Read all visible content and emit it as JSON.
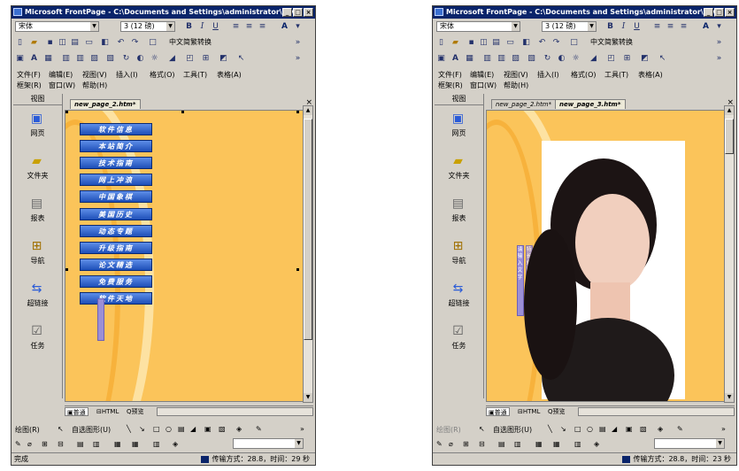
{
  "window_left": {
    "title": "Microsoft FrontPage - C:\\Documents and Settings\\administrator\\My...",
    "font_name": "宋体",
    "font_size": "3 (12 磅)",
    "format_buttons": [
      "B",
      "I",
      "U"
    ],
    "a_button": "A",
    "convert_label": "中文简繁转换",
    "menus_row1": [
      "文件(F)",
      "编辑(E)",
      "视图(V)",
      "插入(I)",
      "格式(O)",
      "工具(T)",
      "表格(A)"
    ],
    "menus_row2": [
      "框架(R)",
      "窗口(W)",
      "帮助(H)"
    ],
    "sidebar_title": "视图",
    "sidebar_items": [
      "网页",
      "文件夹",
      "报表",
      "导航",
      "超链接",
      "任务"
    ],
    "tabs": [
      "new_page_2.htm*"
    ],
    "nav_buttons": [
      "软件信息",
      "本站简介",
      "技术指南",
      "网上冲浪",
      "中国象棋",
      "美国历史",
      "动态专题",
      "升级指南",
      "论文精选",
      "免费服务",
      "软件天地"
    ],
    "view_tabs": [
      "普通",
      "HTML",
      "预览"
    ],
    "draw_label": "绘图(R)",
    "autoshapes_label": "自选图形(U)",
    "status_left": "完成",
    "status_right": "传输方式：28.8，时间：29 秒"
  },
  "window_right": {
    "title": "Microsoft FrontPage - C:\\Documents and Settings\\administrator\\My...",
    "font_name": "宋体",
    "font_size": "3 (12 磅)",
    "format_buttons": [
      "B",
      "I",
      "U"
    ],
    "a_button": "A",
    "convert_label": "中文简繁转换",
    "menus_row1": [
      "文件(F)",
      "编辑(E)",
      "视图(V)",
      "插入(I)",
      "格式(O)",
      "工具(T)",
      "表格(A)"
    ],
    "menus_row2": [
      "框架(R)",
      "窗口(W)",
      "帮助(H)"
    ],
    "sidebar_title": "视图",
    "sidebar_items": [
      "网页",
      "文件夹",
      "报表",
      "导航",
      "超链接",
      "任务"
    ],
    "tabs": [
      "new_page_2.htm*",
      "new_page_3.htm*"
    ],
    "vertical_text": [
      "请 输 入 文 字",
      "特 长 爱 好"
    ],
    "view_tabs": [
      "普通",
      "HTML",
      "预览"
    ],
    "draw_label": "绘图(R)",
    "autoshapes_label": "自选图形(U)",
    "status_left": "",
    "status_right": "传输方式：28.8，时间：23 秒"
  },
  "colors": {
    "titlebar": "#0a246a",
    "page_background": "#fbc45a",
    "nav_button": "#2d5fd0",
    "chrome": "#d4d0c8"
  },
  "icons": {
    "sidebar": [
      "page-icon",
      "folder-icon",
      "reports-icon",
      "navigation-icon",
      "hyperlinks-icon",
      "tasks-icon"
    ]
  }
}
